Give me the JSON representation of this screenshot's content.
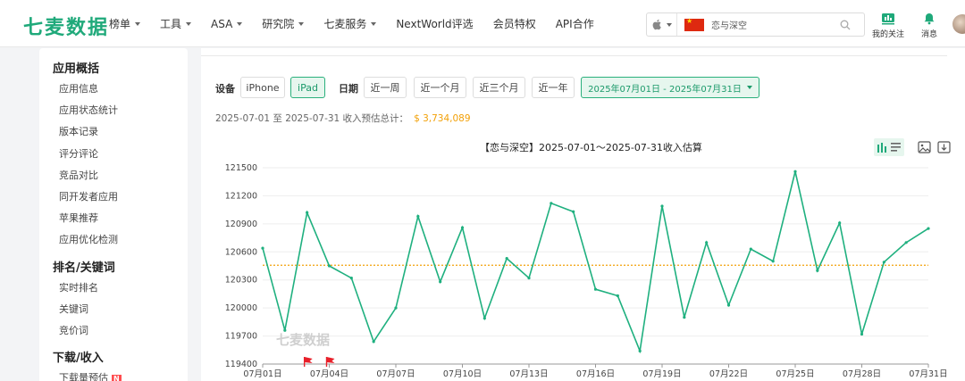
{
  "header": {
    "logo": "七麦数据",
    "nav": [
      {
        "label": "榜单",
        "caret": true
      },
      {
        "label": "工具",
        "caret": true
      },
      {
        "label": "ASA",
        "caret": true
      },
      {
        "label": "研究院",
        "caret": true
      },
      {
        "label": "七麦服务",
        "caret": true
      },
      {
        "label": "NextWorld评选",
        "caret": false
      },
      {
        "label": "会员特权",
        "caret": false
      },
      {
        "label": "API合作",
        "caret": false
      }
    ],
    "search": {
      "value": "恋与深空"
    },
    "my_follow": "我的关注",
    "messages": "消息"
  },
  "sidebar": {
    "groups": [
      {
        "title": "应用概括",
        "items": [
          "应用信息",
          "应用状态统计",
          "版本记录",
          "评分评论",
          "竞品对比",
          "同开发者应用",
          "苹果推荐",
          "应用优化检测"
        ]
      },
      {
        "title": "排名/关键词",
        "items": [
          "实时排名",
          "关键词",
          "竞价词"
        ]
      },
      {
        "title": "下载/收入",
        "items": [
          "下载量预估"
        ]
      }
    ],
    "new_badge": "N"
  },
  "filters": {
    "device_label": "设备",
    "devices": [
      "iPhone",
      "iPad"
    ],
    "active_device": "iPad",
    "date_label": "日期",
    "periods": [
      "近一周",
      "近一个月",
      "近三个月",
      "近一年"
    ],
    "date_range": "2025年07月01日 - 2025年07月31日"
  },
  "summary": {
    "text": "2025-07-01 至 2025-07-31 收入预估总计：",
    "total": "$ 3,734,089"
  },
  "chart_title": "【恋与深空】2025-07-01～2025-07-31收入估算",
  "watermark": "七麦数据",
  "colors": {
    "accent": "#1fa97a",
    "line": "#1fb07f",
    "average": "#f2a007",
    "flag": "#e8202a"
  },
  "chart_data": {
    "type": "line",
    "title": "【恋与深空】2025-07-01～2025-07-31收入估算",
    "xlabel": "",
    "ylabel": "",
    "x": [
      "07月01日",
      "07月02日",
      "07月03日",
      "07月04日",
      "07月05日",
      "07月06日",
      "07月07日",
      "07月08日",
      "07月09日",
      "07月10日",
      "07月11日",
      "07月12日",
      "07月13日",
      "07月14日",
      "07月15日",
      "07月16日",
      "07月17日",
      "07月18日",
      "07月19日",
      "07月20日",
      "07月21日",
      "07月22日",
      "07月23日",
      "07月24日",
      "07月25日",
      "07月26日",
      "07月27日",
      "07月28日",
      "07月29日",
      "07月30日",
      "07月31日"
    ],
    "series": [
      {
        "values": [
          120640,
          119760,
          121020,
          120450,
          120320,
          119640,
          120000,
          120980,
          120280,
          120860,
          119890,
          120530,
          120320,
          121120,
          121030,
          120200,
          120130,
          119540,
          121090,
          119900,
          120700,
          120030,
          120630,
          120500,
          121460,
          120400,
          120910,
          119720,
          120490,
          120700,
          120850
        ]
      }
    ],
    "average": 120457,
    "ylim": [
      119400,
      121500
    ],
    "yticks": [
      119400,
      119700,
      120000,
      120300,
      120600,
      120900,
      121200,
      121500
    ],
    "xticks": [
      "07月01日",
      "07月04日",
      "07月07日",
      "07月10日",
      "07月13日",
      "07月16日",
      "07月19日",
      "07月22日",
      "07月25日",
      "07月28日",
      "07月31日"
    ],
    "event_flags": [
      "07月03日",
      "07月04日"
    ],
    "grid": "horizontal",
    "legend": "none"
  }
}
